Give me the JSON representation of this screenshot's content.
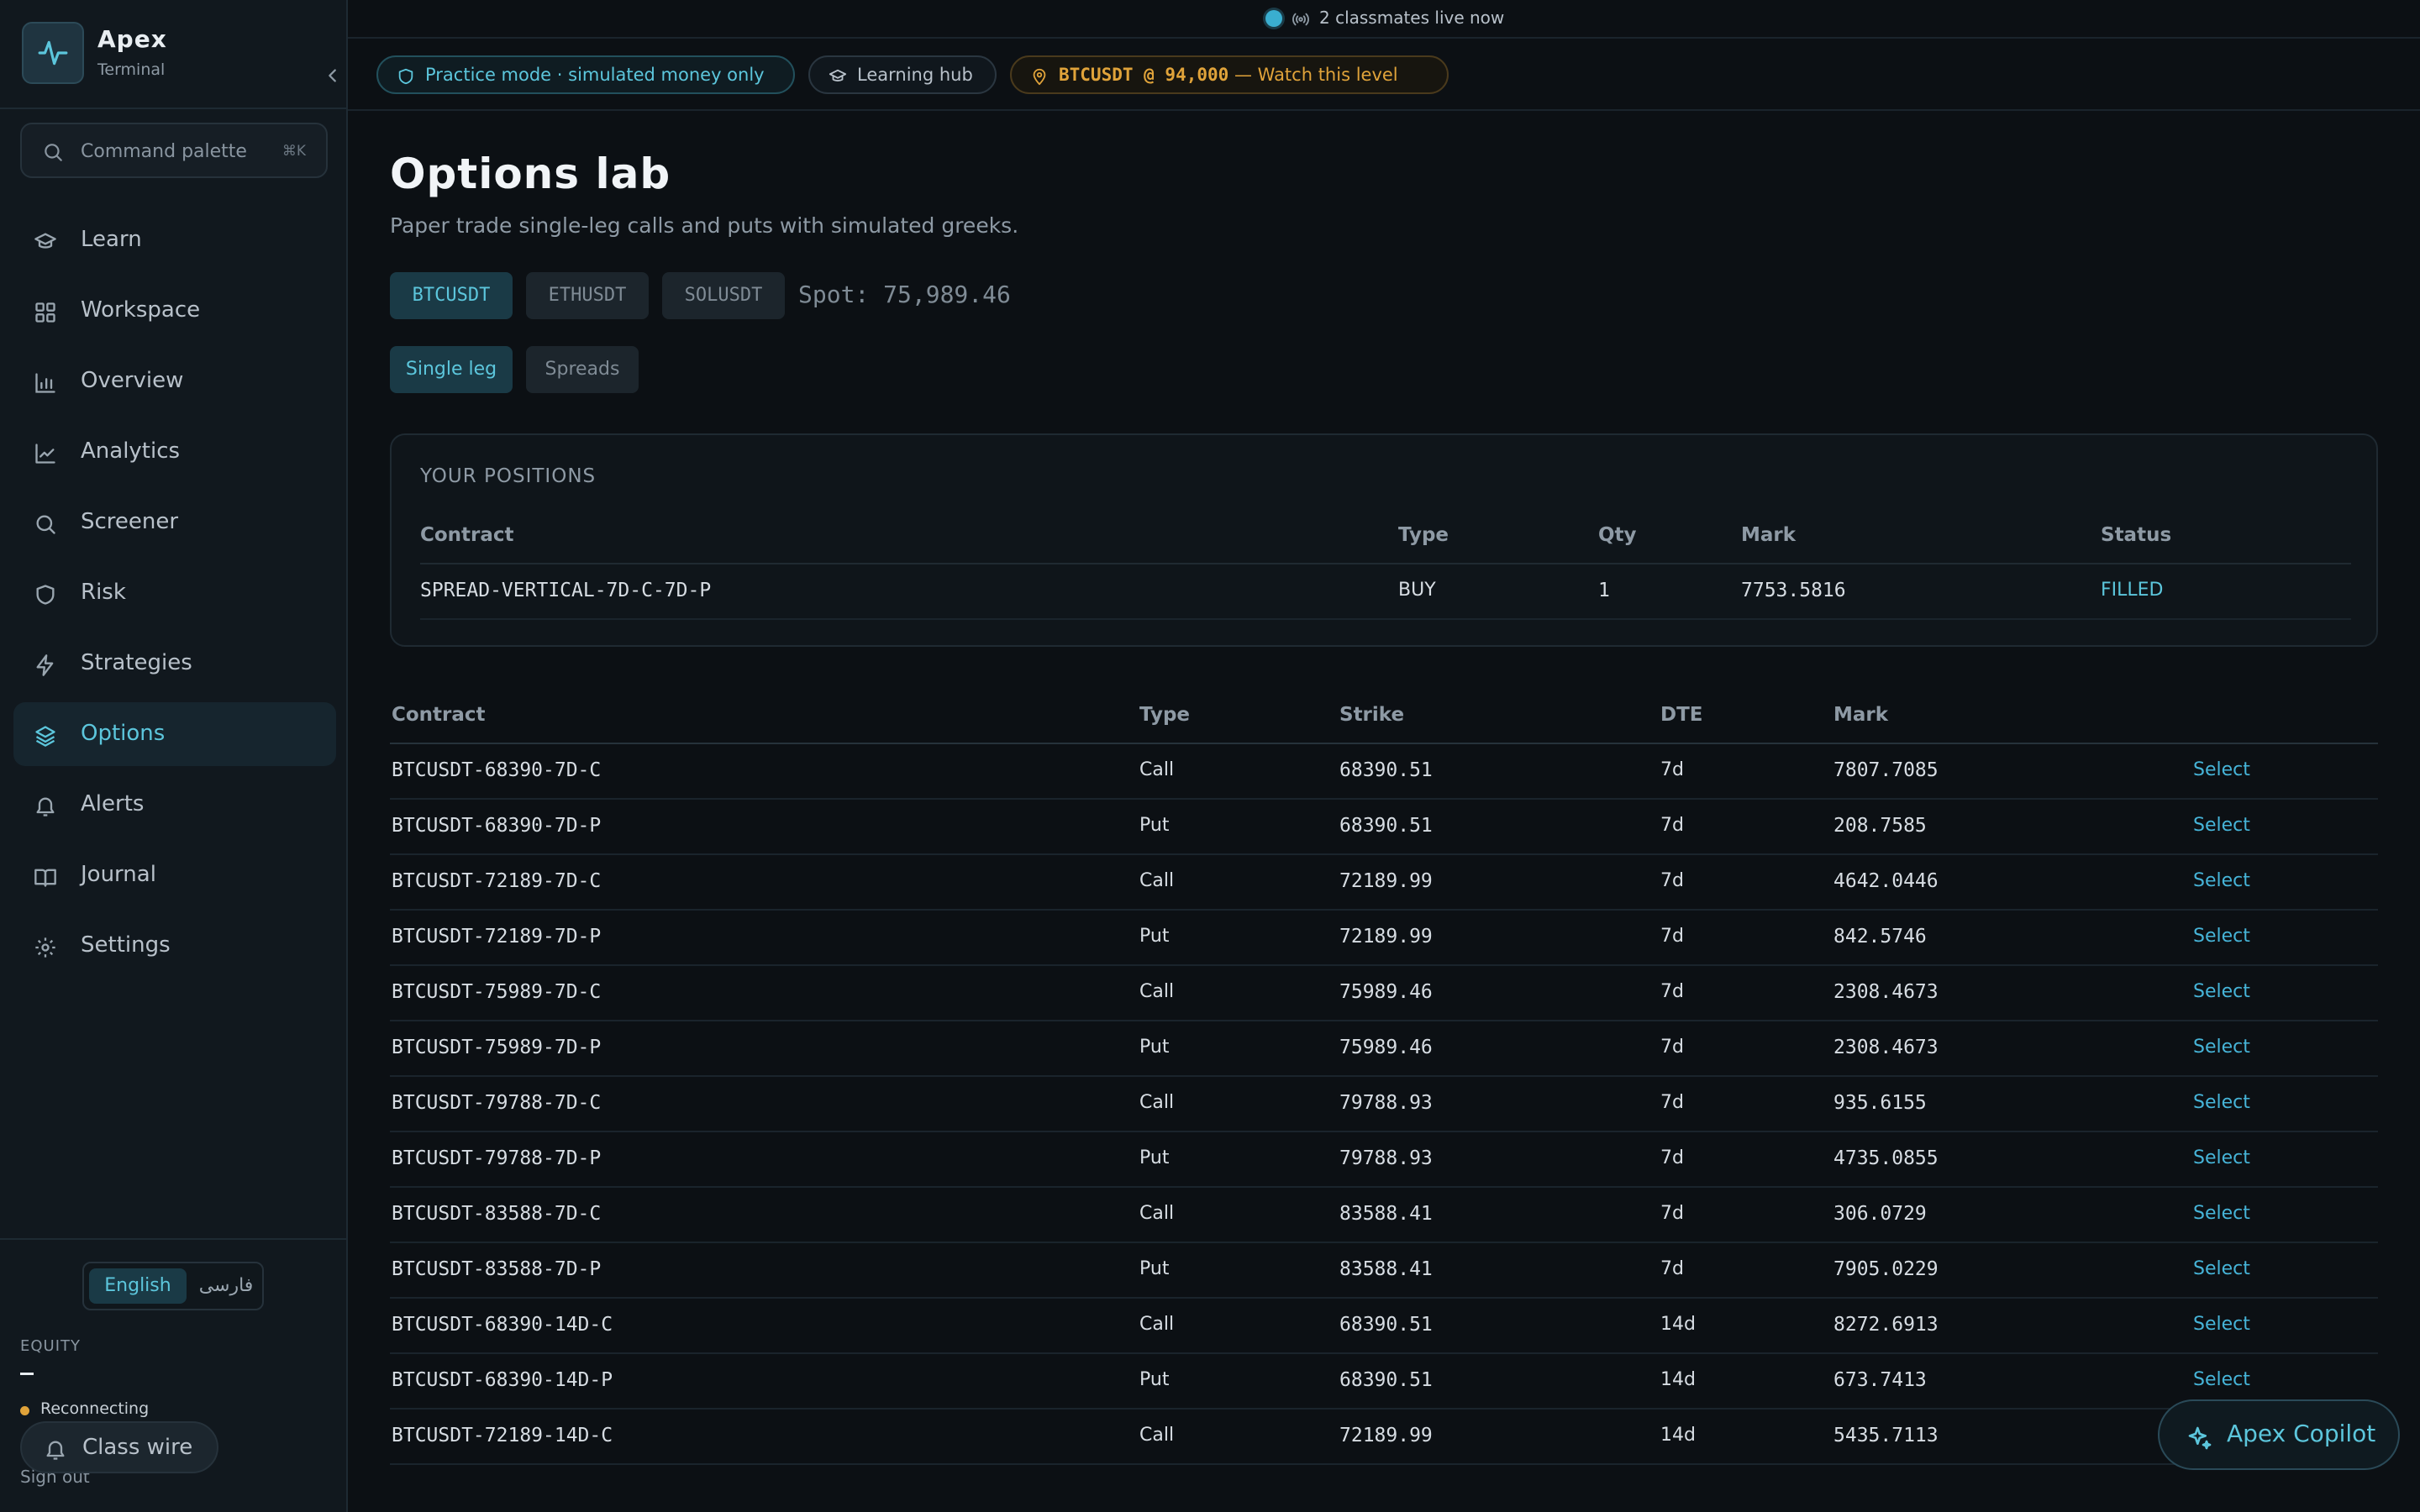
{
  "brand": {
    "name": "Apex",
    "subtitle": "Terminal"
  },
  "command_palette": {
    "label": "Command palette",
    "shortcut": "⌘K"
  },
  "nav": [
    {
      "label": "Learn",
      "icon": "graduation-cap-icon"
    },
    {
      "label": "Workspace",
      "icon": "grid-icon"
    },
    {
      "label": "Overview",
      "icon": "bar-chart-icon"
    },
    {
      "label": "Analytics",
      "icon": "line-chart-icon"
    },
    {
      "label": "Screener",
      "icon": "search-icon"
    },
    {
      "label": "Risk",
      "icon": "shield-icon"
    },
    {
      "label": "Strategies",
      "icon": "lightning-icon"
    },
    {
      "label": "Options",
      "icon": "layers-icon",
      "active": true
    },
    {
      "label": "Alerts",
      "icon": "bell-icon"
    },
    {
      "label": "Journal",
      "icon": "book-icon"
    },
    {
      "label": "Settings",
      "icon": "gear-icon"
    }
  ],
  "language": {
    "english": "English",
    "farsi": "فارسی",
    "selected": "English"
  },
  "equity": {
    "label": "EQUITY",
    "value": "—"
  },
  "connection": {
    "status": "Reconnecting"
  },
  "class_wire": {
    "label": "Class wire"
  },
  "sign_out": "Sign out",
  "live": {
    "text": "2 classmates live now"
  },
  "chips": {
    "practice": "Practice mode · simulated money only",
    "learning": "Learning hub",
    "alert_symbol": "BTCUSDT @ 94,000",
    "alert_text": " — Watch this level"
  },
  "page": {
    "title": "Options lab",
    "subtitle": "Paper trade single-leg calls and puts with simulated greeks."
  },
  "symbols": [
    {
      "label": "BTCUSDT",
      "active": true
    },
    {
      "label": "ETHUSDT",
      "active": false
    },
    {
      "label": "SOLUSDT",
      "active": false
    }
  ],
  "spot": "Spot: 75,989.46",
  "modes": [
    {
      "label": "Single leg",
      "active": true
    },
    {
      "label": "Spreads",
      "active": false
    }
  ],
  "positions": {
    "title": "YOUR POSITIONS",
    "headers": [
      "Contract",
      "Type",
      "Qty",
      "Mark",
      "Status"
    ],
    "rows": [
      {
        "contract": "SPREAD-VERTICAL-7D-C-7D-P",
        "type": "BUY",
        "qty": "1",
        "mark": "7753.5816",
        "status": "FILLED"
      }
    ]
  },
  "chain": {
    "headers": [
      "Contract",
      "Type",
      "Strike",
      "DTE",
      "Mark"
    ],
    "action_label": "Select",
    "rows": [
      {
        "contract": "BTCUSDT-68390-7D-C",
        "type": "Call",
        "strike": "68390.51",
        "dte": "7d",
        "mark": "7807.7085"
      },
      {
        "contract": "BTCUSDT-68390-7D-P",
        "type": "Put",
        "strike": "68390.51",
        "dte": "7d",
        "mark": "208.7585"
      },
      {
        "contract": "BTCUSDT-72189-7D-C",
        "type": "Call",
        "strike": "72189.99",
        "dte": "7d",
        "mark": "4642.0446"
      },
      {
        "contract": "BTCUSDT-72189-7D-P",
        "type": "Put",
        "strike": "72189.99",
        "dte": "7d",
        "mark": "842.5746"
      },
      {
        "contract": "BTCUSDT-75989-7D-C",
        "type": "Call",
        "strike": "75989.46",
        "dte": "7d",
        "mark": "2308.4673"
      },
      {
        "contract": "BTCUSDT-75989-7D-P",
        "type": "Put",
        "strike": "75989.46",
        "dte": "7d",
        "mark": "2308.4673"
      },
      {
        "contract": "BTCUSDT-79788-7D-C",
        "type": "Call",
        "strike": "79788.93",
        "dte": "7d",
        "mark": "935.6155"
      },
      {
        "contract": "BTCUSDT-79788-7D-P",
        "type": "Put",
        "strike": "79788.93",
        "dte": "7d",
        "mark": "4735.0855"
      },
      {
        "contract": "BTCUSDT-83588-7D-C",
        "type": "Call",
        "strike": "83588.41",
        "dte": "7d",
        "mark": "306.0729"
      },
      {
        "contract": "BTCUSDT-83588-7D-P",
        "type": "Put",
        "strike": "83588.41",
        "dte": "7d",
        "mark": "7905.0229"
      },
      {
        "contract": "BTCUSDT-68390-14D-C",
        "type": "Call",
        "strike": "68390.51",
        "dte": "14d",
        "mark": "8272.6913"
      },
      {
        "contract": "BTCUSDT-68390-14D-P",
        "type": "Put",
        "strike": "68390.51",
        "dte": "14d",
        "mark": "673.7413"
      },
      {
        "contract": "BTCUSDT-72189-14D-C",
        "type": "Call",
        "strike": "72189.99",
        "dte": "14d",
        "mark": "5435.7113"
      }
    ]
  },
  "copilot": {
    "label": "Apex Copilot"
  },
  "colors": {
    "accent": "#5cc6dc",
    "warning": "#e0a33a",
    "background": "#0c1014"
  }
}
